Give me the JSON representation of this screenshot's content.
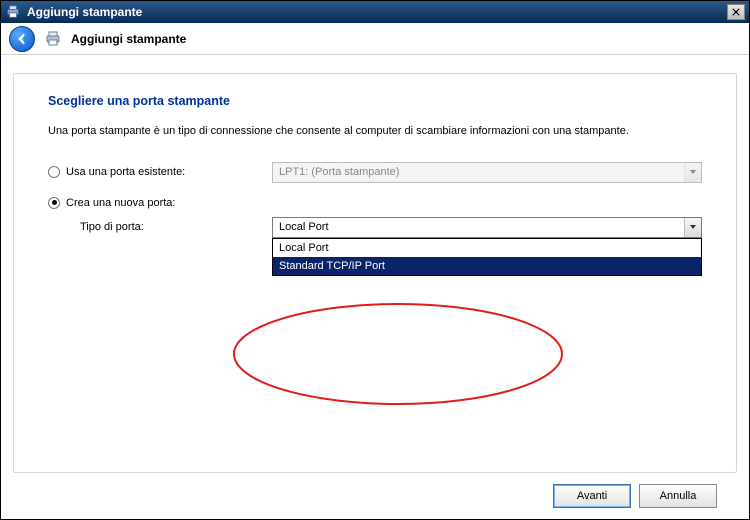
{
  "window": {
    "title": "Aggiungi stampante"
  },
  "header": {
    "title": "Aggiungi stampante"
  },
  "page": {
    "heading": "Scegliere una porta stampante",
    "description": "Una porta stampante è un tipo di connessione che consente al computer di scambiare informazioni con una stampante."
  },
  "options": {
    "use_existing": {
      "label": "Usa una porta esistente:",
      "checked": false,
      "combo_value": "LPT1: (Porta stampante)"
    },
    "create_new": {
      "label": "Crea una nuova porta:",
      "checked": true
    },
    "port_type": {
      "label": "Tipo di porta:",
      "selected": "Local Port",
      "options": [
        "Local Port",
        "Standard TCP/IP Port"
      ],
      "highlight_index": 1
    }
  },
  "buttons": {
    "next": "Avanti",
    "cancel": "Annulla"
  },
  "icons": {
    "printer": "printer",
    "back_arrow": "←",
    "close": "✕",
    "chevron_down": "▾"
  },
  "annotation": {
    "ellipse_stroke": "#e11c1c"
  }
}
